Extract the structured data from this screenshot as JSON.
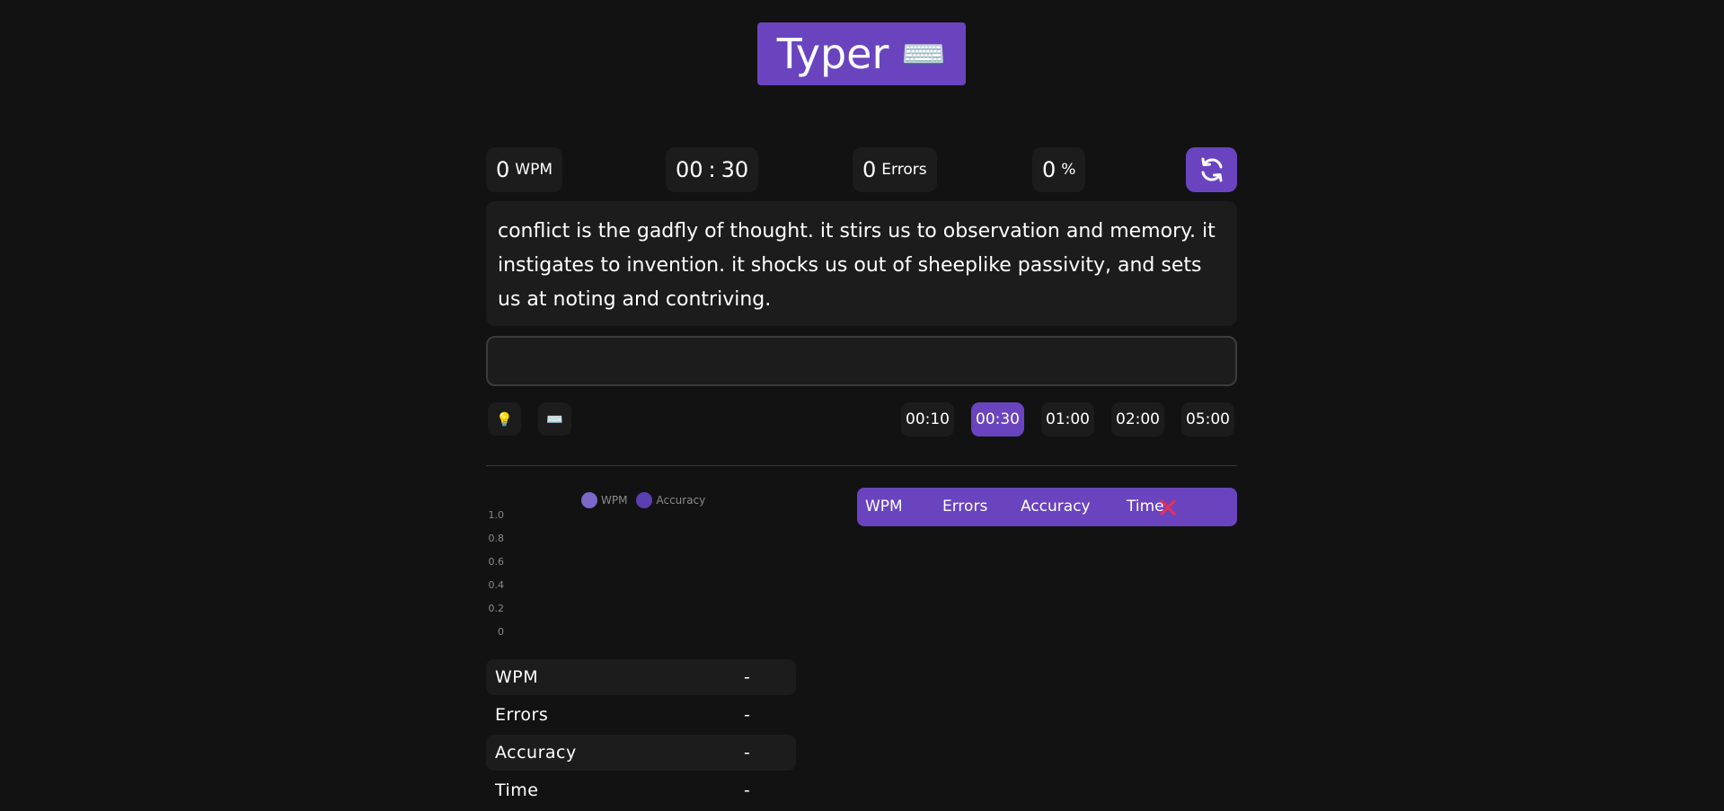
{
  "header": {
    "title": "Typer",
    "keyboard_emoji": "⌨️"
  },
  "stats": {
    "wpm_value": "0",
    "wpm_unit": "WPM",
    "timer_min": "00",
    "timer_sep": ":",
    "timer_sec": "30",
    "errors_value": "0",
    "errors_unit": "Errors",
    "accuracy_value": "0",
    "accuracy_unit": "%"
  },
  "reset_button": {
    "icon": "refresh-icon"
  },
  "quote": {
    "text": "conflict is the gadfly of thought. it stirs us to observation and memory. it instigates to invention. it shocks us out of sheeplike passivity, and sets us at noting and contriving."
  },
  "typing_input": {
    "value": "",
    "placeholder": ""
  },
  "tools": {
    "hint_icon": "💡",
    "keyboard_icon": "⌨️"
  },
  "durations": {
    "options": [
      "00:10",
      "00:30",
      "01:00",
      "02:00",
      "05:00"
    ],
    "selected": "00:30"
  },
  "chart_data": {
    "type": "line",
    "series": [
      {
        "name": "WPM",
        "values": [],
        "color": "#7b68c8"
      },
      {
        "name": "Accuracy",
        "values": [],
        "color": "#5b3fb0"
      }
    ],
    "y_ticks": [
      "1.0",
      "0.8",
      "0.6",
      "0.4",
      "0.2",
      "0"
    ],
    "ylim": [
      0,
      1
    ],
    "legend_placement": "top"
  },
  "results": [
    {
      "label": "WPM",
      "value": "-"
    },
    {
      "label": "Errors",
      "value": "-"
    },
    {
      "label": "Accuracy",
      "value": "-"
    },
    {
      "label": "Time",
      "value": "-"
    }
  ],
  "history": {
    "columns": [
      "WPM",
      "Errors",
      "Accuracy",
      "Time"
    ],
    "clear_icon": "close-icon",
    "clear_color": "#e0315b"
  },
  "colors": {
    "accent": "#6a44bf",
    "panel": "#1c1c1c",
    "background": "#121212"
  }
}
